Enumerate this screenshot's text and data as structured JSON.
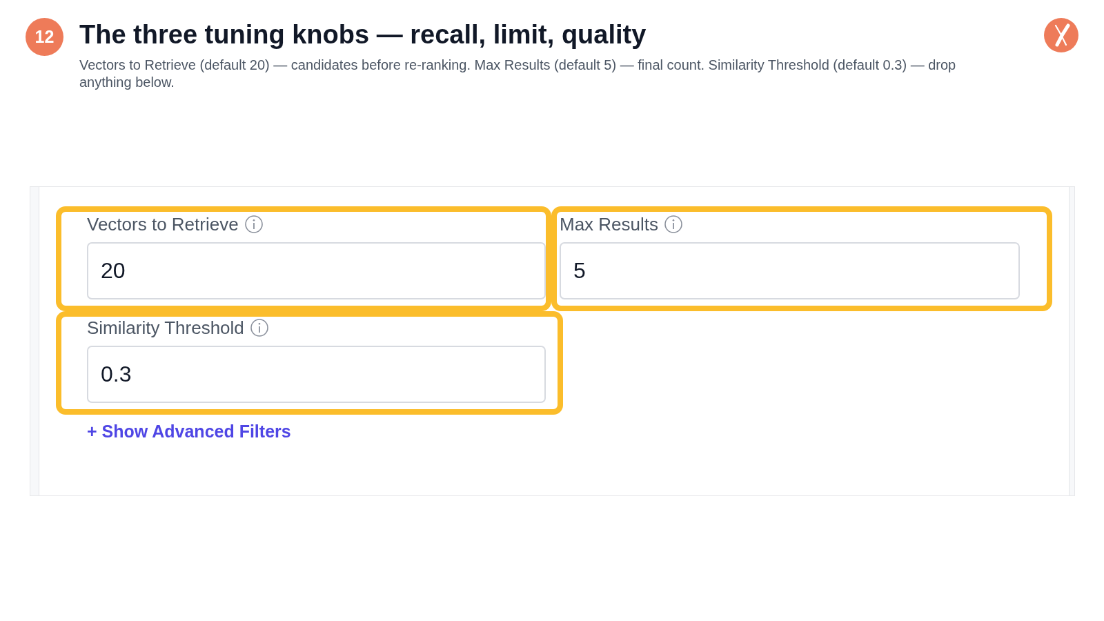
{
  "slide": {
    "number": "12",
    "title": "The three tuning knobs — recall, limit, quality",
    "subtitle": "Vectors to Retrieve (default 20) — candidates before re-ranking. Max Results (default 5) — final count. Similarity Threshold (default 0.3) — drop anything below."
  },
  "form": {
    "fields": [
      {
        "label": "Vectors to Retrieve",
        "value": "20",
        "highlighted": true
      },
      {
        "label": "Max Results",
        "value": "5",
        "highlighted": true
      },
      {
        "label": "Similarity Threshold",
        "value": "0.3",
        "highlighted": true
      }
    ],
    "advanced_filters_link": "+ Show Advanced Filters"
  }
}
